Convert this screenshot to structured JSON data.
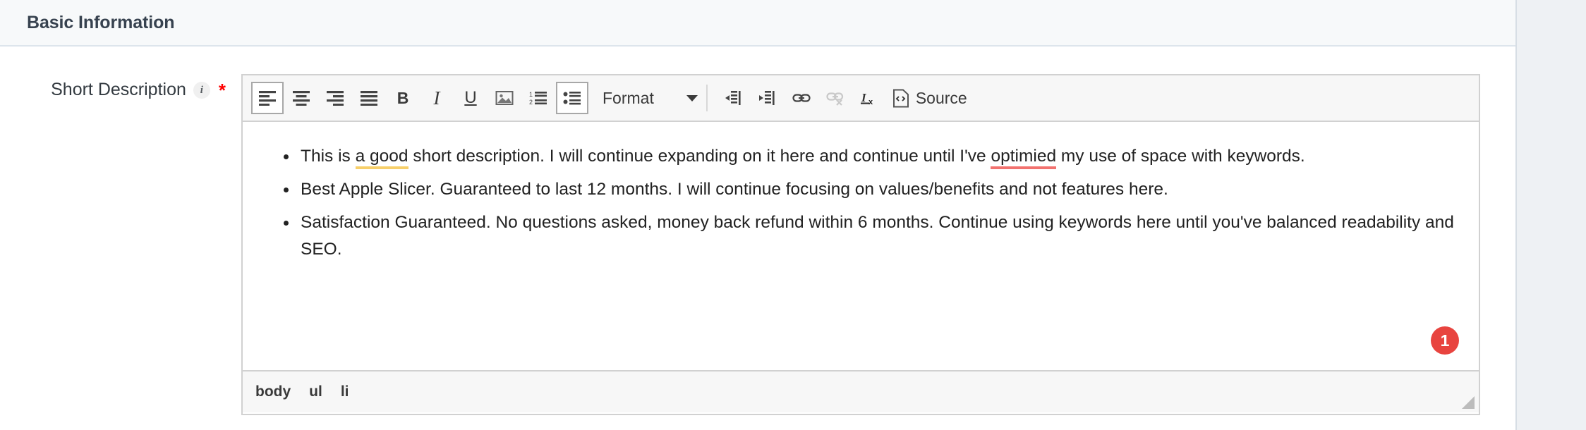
{
  "section": {
    "title": "Basic Information"
  },
  "field": {
    "label": "Short Description",
    "info_icon": "info-icon",
    "required_marker": "*"
  },
  "toolbar": {
    "buttons": [
      {
        "name": "align-left-icon",
        "label": "Align Left",
        "active": true,
        "disabled": false
      },
      {
        "name": "align-center-icon",
        "label": "Center",
        "active": false,
        "disabled": false
      },
      {
        "name": "align-right-icon",
        "label": "Align Right",
        "active": false,
        "disabled": false
      },
      {
        "name": "justify-icon",
        "label": "Justify",
        "active": false,
        "disabled": false
      },
      {
        "name": "bold-icon",
        "label": "B",
        "active": false,
        "disabled": false
      },
      {
        "name": "italic-icon",
        "label": "I",
        "active": false,
        "disabled": false
      },
      {
        "name": "underline-icon",
        "label": "U",
        "active": false,
        "disabled": false
      },
      {
        "name": "image-icon",
        "label": "Image",
        "active": false,
        "disabled": false
      },
      {
        "name": "numbered-list-icon",
        "label": "Insert/Remove Numbered List",
        "active": false,
        "disabled": false
      },
      {
        "name": "bulleted-list-icon",
        "label": "Insert/Remove Bulleted List",
        "active": true,
        "disabled": false
      }
    ],
    "format_dropdown": {
      "label": "Format",
      "caret": "chevron-down-icon"
    },
    "buttons2": [
      {
        "name": "decrease-indent-icon",
        "label": "Decrease Indent",
        "active": false,
        "disabled": false
      },
      {
        "name": "increase-indent-icon",
        "label": "Increase Indent",
        "active": false,
        "disabled": false
      },
      {
        "name": "link-icon",
        "label": "Link",
        "active": false,
        "disabled": false
      },
      {
        "name": "unlink-icon",
        "label": "Unlink",
        "active": false,
        "disabled": true
      },
      {
        "name": "remove-format-icon",
        "label": "Remove Format",
        "active": false,
        "disabled": false
      }
    ],
    "source_button": {
      "label": "Source",
      "icon": "source-code-icon"
    }
  },
  "content": {
    "bullets": [
      {
        "parts": [
          {
            "text": "This is ",
            "style": "normal"
          },
          {
            "text": "a good",
            "style": "grammar"
          },
          {
            "text": " short description. I will continue expanding on it here and continue until I've ",
            "style": "normal"
          },
          {
            "text": "optimied",
            "style": "spelling"
          },
          {
            "text": " my use of space with keywords.",
            "style": "normal"
          }
        ]
      },
      {
        "parts": [
          {
            "text": "Best Apple Slicer. Guaranteed to last 12 months. I will continue focusing on values/benefits and not features here.",
            "style": "normal"
          }
        ]
      },
      {
        "parts": [
          {
            "text": "Satisfaction Guaranteed. No questions asked, money back refund within 6 months. Continue using keywords here until you've balanced readability and SEO.",
            "style": "normal"
          }
        ]
      }
    ],
    "badge_count": "1"
  },
  "footer": {
    "element_path": [
      "body",
      "ul",
      "li"
    ],
    "resize_grip": "resize-handle-icon"
  },
  "colors": {
    "header_bg": "#f7f9fa",
    "header_text": "#37424f",
    "toolbar_bg": "#f7f7f7",
    "badge_red": "#e8443f",
    "grammar_underline": "#f7cf6a",
    "spelling_underline": "#f2726f",
    "required_red": "#ff0000",
    "border": "#d1d1d1"
  }
}
